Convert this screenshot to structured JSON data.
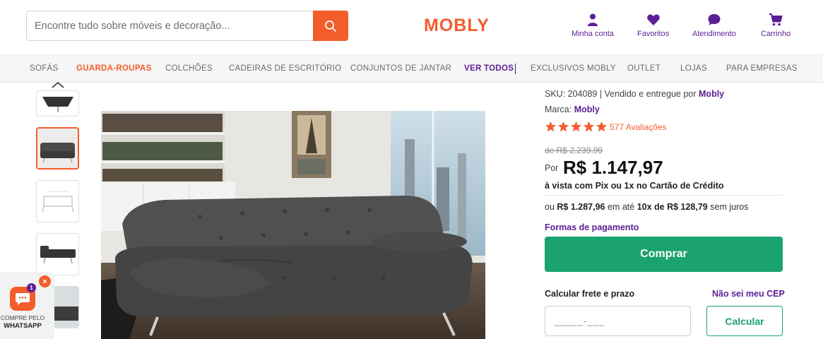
{
  "header": {
    "search": {
      "placeholder": "Encontre tudo sobre móveis e decoração..."
    },
    "logo": "MOBLY",
    "actions": [
      {
        "label": "Minha conta",
        "icon": "user-icon"
      },
      {
        "label": "Favoritos",
        "icon": "heart-icon"
      },
      {
        "label": "Atendimento",
        "icon": "chat-icon"
      },
      {
        "label": "Carrinho",
        "icon": "cart-icon"
      }
    ]
  },
  "nav": {
    "items": [
      {
        "label": "SOFÁS"
      },
      {
        "label": "GUARDA-ROUPAS",
        "active": true
      },
      {
        "label": "COLCHÕES"
      },
      {
        "label": "CADEIRAS DE ESCRITÓRIO"
      },
      {
        "label": "CONJUNTOS DE JANTAR"
      },
      {
        "label": "VER TODOS"
      },
      {
        "label": "EXCLUSIVOS MOBLY"
      },
      {
        "label": "OUTLET"
      },
      {
        "label": "LOJAS"
      },
      {
        "label": "PARA EMPRESAS"
      }
    ]
  },
  "product": {
    "sku_label": "SKU: 204089 | Vendido e entregue por",
    "seller": "Mobly",
    "brand_label": "Marca:",
    "brand": "Mobly",
    "rating_stars": 5,
    "reviews": "577 Avaliações",
    "old_price": "de R$ 2.239,99",
    "por": "Por",
    "price": "R$ 1.147,97",
    "pix_text": "à vista com Pix ou 1x no Cartão de Crédito",
    "install_prefix": "ou",
    "install_total": "R$ 1.287,96",
    "install_mid": "em até",
    "install_parcel": "10x de R$ 128,79",
    "install_suffix": "sem juros",
    "payment_link": "Formas de pagamento",
    "buy_button": "Comprar",
    "shipping_label": "Calcular frete e prazo",
    "no_cep_link": "Não sei meu CEP",
    "cep_placeholder": "_____-___",
    "calc_button": "Calcular"
  },
  "whatsapp": {
    "badge": "1",
    "close": "×",
    "line1": "COMPRE PELO",
    "line2": "WHATSAPP"
  },
  "colors": {
    "brand_orange": "#f35d2b",
    "brand_purple": "#5c1e96",
    "buy_green": "#1aa36e"
  }
}
